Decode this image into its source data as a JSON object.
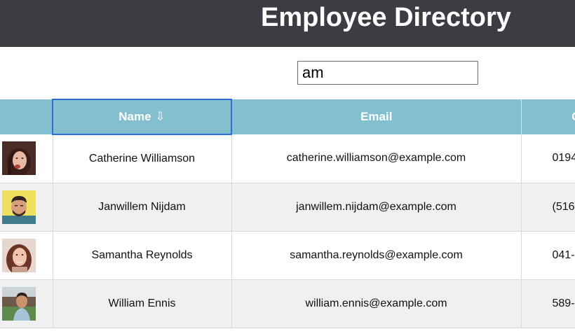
{
  "header": {
    "title": "Employee Directory"
  },
  "search": {
    "value": "am"
  },
  "table": {
    "columns": {
      "image": "",
      "name": "Name",
      "name_sort_arrow": "⇩",
      "email": "Email",
      "phone": "O"
    },
    "rows": [
      {
        "avatar_icon": "avatar-photo-woman-dark-hair",
        "name": "Catherine Williamson",
        "email": "catherine.williamson@example.com",
        "phone": "0194"
      },
      {
        "avatar_icon": "avatar-photo-man-yellow-background",
        "name": "Janwillem Nijdam",
        "email": "janwillem.nijdam@example.com",
        "phone": "(516)"
      },
      {
        "avatar_icon": "avatar-photo-woman-smiling",
        "name": "Samantha Reynolds",
        "email": "samantha.reynolds@example.com",
        "phone": "041-"
      },
      {
        "avatar_icon": "avatar-photo-man-outdoors",
        "name": "William Ennis",
        "email": "william.ennis@example.com",
        "phone": "589-"
      }
    ]
  },
  "colors": {
    "header_bg": "#3b3d42",
    "table_header_bg": "#83bfce",
    "sort_focus_border": "#2a6fd1",
    "alt_row_bg": "#f0f0f0"
  }
}
